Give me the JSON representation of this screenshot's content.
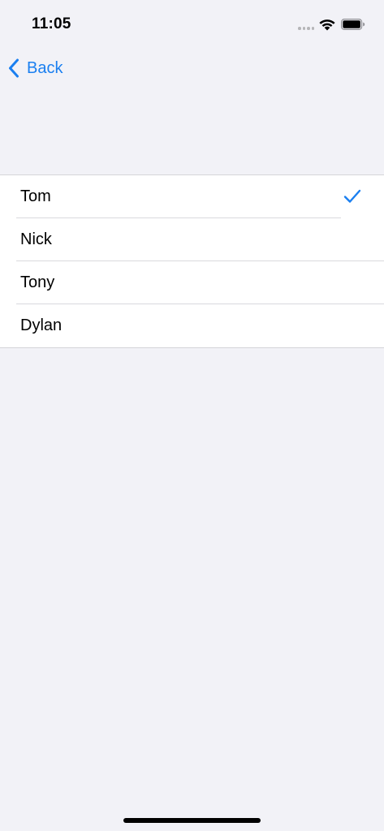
{
  "status_bar": {
    "time": "11:05"
  },
  "nav": {
    "back_label": "Back"
  },
  "list": {
    "items": [
      {
        "label": "Tom",
        "selected": true
      },
      {
        "label": "Nick",
        "selected": false
      },
      {
        "label": "Tony",
        "selected": false
      },
      {
        "label": "Dylan",
        "selected": false
      }
    ]
  },
  "colors": {
    "accent": "#1a7ff0",
    "background": "#f2f2f7",
    "cell": "#ffffff",
    "separator": "#d9d9dd"
  },
  "icons": {
    "back": "chevron-left-icon",
    "selected": "checkmark-icon",
    "wifi": "wifi-icon",
    "battery": "battery-icon",
    "signal": "cellular-signal-icon"
  }
}
